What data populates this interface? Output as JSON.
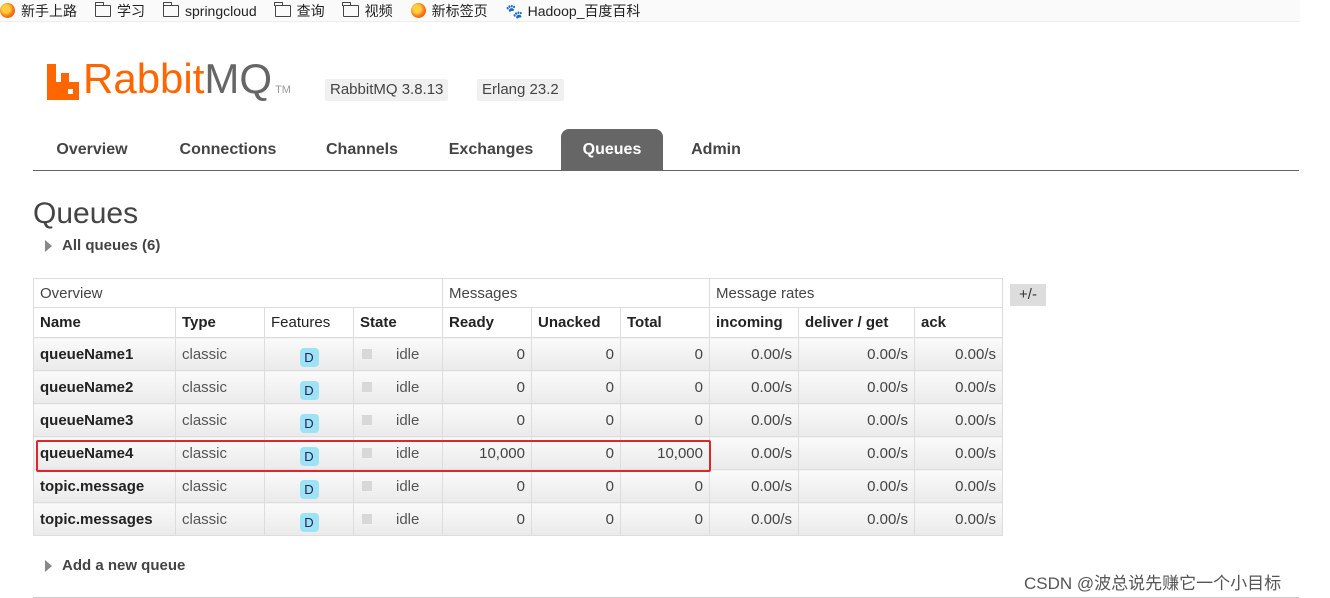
{
  "bookmarks": [
    {
      "label": "新手上路",
      "icon": "firefox-icon"
    },
    {
      "label": "学习",
      "icon": "folder-icon"
    },
    {
      "label": "springcloud",
      "icon": "folder-icon"
    },
    {
      "label": "查询",
      "icon": "folder-icon"
    },
    {
      "label": "视频",
      "icon": "folder-icon"
    },
    {
      "label": "新标签页",
      "icon": "firefox-icon"
    },
    {
      "label": "Hadoop_百度百科",
      "icon": "baidu-paw-icon"
    }
  ],
  "header": {
    "logo_rabbit": "Rabbit",
    "logo_mq": "MQ",
    "logo_tm": "TM",
    "rabbitmq_version": "RabbitMQ 3.8.13",
    "erlang_version": "Erlang 23.2"
  },
  "tabs": [
    {
      "label": "Overview",
      "active": false
    },
    {
      "label": "Connections",
      "active": false
    },
    {
      "label": "Channels",
      "active": false
    },
    {
      "label": "Exchanges",
      "active": false
    },
    {
      "label": "Queues",
      "active": true
    },
    {
      "label": "Admin",
      "active": false
    }
  ],
  "page": {
    "title": "Queues",
    "all_queues_label": "All queues (6)",
    "add_queue_label": "Add a new queue",
    "columns_toggle": "+/-"
  },
  "table": {
    "groups": {
      "overview": "Overview",
      "messages": "Messages",
      "rates": "Message rates"
    },
    "headers": {
      "name": "Name",
      "type": "Type",
      "features": "Features",
      "state": "State",
      "ready": "Ready",
      "unacked": "Unacked",
      "total": "Total",
      "incoming": "incoming",
      "deliver_get": "deliver / get",
      "ack": "ack"
    },
    "rows": [
      {
        "name": "queueName1",
        "type": "classic",
        "feature": "D",
        "state": "idle",
        "ready": "0",
        "unacked": "0",
        "total": "0",
        "incoming": "0.00/s",
        "deliver_get": "0.00/s",
        "ack": "0.00/s"
      },
      {
        "name": "queueName2",
        "type": "classic",
        "feature": "D",
        "state": "idle",
        "ready": "0",
        "unacked": "0",
        "total": "0",
        "incoming": "0.00/s",
        "deliver_get": "0.00/s",
        "ack": "0.00/s"
      },
      {
        "name": "queueName3",
        "type": "classic",
        "feature": "D",
        "state": "idle",
        "ready": "0",
        "unacked": "0",
        "total": "0",
        "incoming": "0.00/s",
        "deliver_get": "0.00/s",
        "ack": "0.00/s"
      },
      {
        "name": "queueName4",
        "type": "classic",
        "feature": "D",
        "state": "idle",
        "ready": "10,000",
        "unacked": "0",
        "total": "10,000",
        "incoming": "0.00/s",
        "deliver_get": "0.00/s",
        "ack": "0.00/s"
      },
      {
        "name": "topic.message",
        "type": "classic",
        "feature": "D",
        "state": "idle",
        "ready": "0",
        "unacked": "0",
        "total": "0",
        "incoming": "0.00/s",
        "deliver_get": "0.00/s",
        "ack": "0.00/s"
      },
      {
        "name": "topic.messages",
        "type": "classic",
        "feature": "D",
        "state": "idle",
        "ready": "0",
        "unacked": "0",
        "total": "0",
        "incoming": "0.00/s",
        "deliver_get": "0.00/s",
        "ack": "0.00/s"
      }
    ]
  },
  "annotation": {
    "highlight_color": "#e0262b"
  },
  "watermark": "CSDN @波总说先赚它一个小目标",
  "colors": {
    "brand": "#ff6600",
    "tab_active": "#666666",
    "feature_badge": "#9ee3f5"
  }
}
